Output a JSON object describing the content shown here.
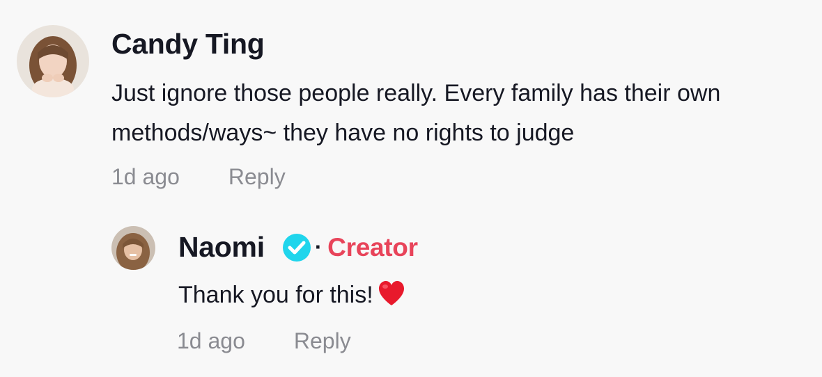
{
  "comments": [
    {
      "author": "Candy Ting",
      "text": "Just ignore those people really. Every family has their own methods/ways~ they have no rights to judge",
      "time": "1d ago",
      "reply_label": "Reply"
    }
  ],
  "reply": {
    "author": "Naomi",
    "verified": true,
    "separator": "·",
    "badge": "Creator",
    "text": "Thank you for this!",
    "emoji": "red-heart",
    "time": "1d ago",
    "reply_label": "Reply"
  },
  "colors": {
    "background": "#f8f8f8",
    "text": "#161823",
    "muted": "#8a8b91",
    "creator_badge": "#e8445a",
    "verified": "#20d5ec"
  }
}
